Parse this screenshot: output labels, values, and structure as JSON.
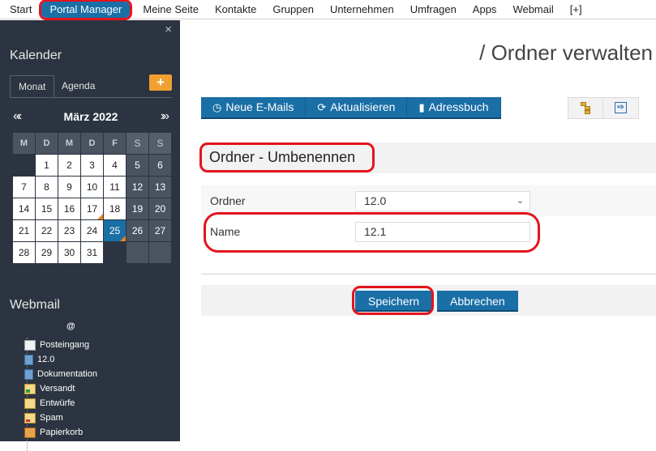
{
  "topnav": {
    "items": [
      "Start",
      "Portal Manager",
      "Meine Seite",
      "Kontakte",
      "Gruppen",
      "Unternehmen",
      "Umfragen",
      "Apps",
      "Webmail",
      "[+]"
    ]
  },
  "sidebar": {
    "close": "×",
    "calendar_title": "Kalender",
    "tabs": [
      "Monat",
      "Agenda"
    ],
    "add_label": "+",
    "prev": "«‹",
    "month": "März 2022",
    "next": "›»",
    "weekdays": [
      "M",
      "D",
      "M",
      "D",
      "F",
      "S",
      "S"
    ],
    "days": [
      [
        "",
        "1",
        "2",
        "3",
        "4",
        "5",
        "6"
      ],
      [
        "7",
        "8",
        "9",
        "10",
        "11",
        "12",
        "13"
      ],
      [
        "14",
        "15",
        "16",
        "17",
        "18",
        "19",
        "20"
      ],
      [
        "21",
        "22",
        "23",
        "24",
        "25",
        "26",
        "27"
      ],
      [
        "28",
        "29",
        "30",
        "31",
        "",
        "",
        ""
      ]
    ],
    "today": "25",
    "marked": [
      "17",
      "25"
    ],
    "webmail_title": "Webmail",
    "folder_root": "@",
    "folders": [
      {
        "label": "Posteingang",
        "icon": "inbox"
      },
      {
        "label": "12.0",
        "icon": "folder"
      },
      {
        "label": "Dokumentation",
        "icon": "folder"
      },
      {
        "label": "Versandt",
        "icon": "sent"
      },
      {
        "label": "Entwürfe",
        "icon": "drafts"
      },
      {
        "label": "Spam",
        "icon": "spam"
      },
      {
        "label": "Papierkorb",
        "icon": "trash"
      }
    ]
  },
  "main": {
    "title": "/ Ordner verwalten",
    "toolbar": {
      "new_mail": "Neue E-Mails",
      "refresh": "Aktualisieren",
      "addressbook": "Adressbuch"
    },
    "form": {
      "heading": "Ordner - Umbenennen",
      "folder_label": "Ordner",
      "folder_value": "12.0",
      "name_label": "Name",
      "name_value": "12.1"
    },
    "actions": {
      "save": "Speichern",
      "cancel": "Abbrechen"
    }
  },
  "colors": {
    "accent": "#1a6fa7",
    "highlight_ring": "#e3141e",
    "sidebar_bg": "#2b3440",
    "add_button": "#f0a030"
  }
}
